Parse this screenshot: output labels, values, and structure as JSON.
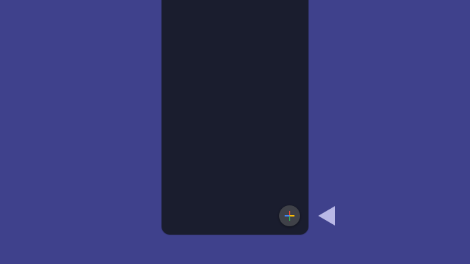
{
  "screen": {
    "background_color": "#3f418c",
    "panel_color": "#1a1d2e"
  },
  "fab": {
    "icon": "google-plus-icon",
    "background_color": "#3f4148",
    "cross_colors": {
      "top": "#ea4335",
      "right": "#fbbc05",
      "bottom": "#34a853",
      "left": "#4285f4"
    }
  },
  "navigation": {
    "back_icon": "back-triangle-icon",
    "icon_color": "#b9b8e6"
  }
}
